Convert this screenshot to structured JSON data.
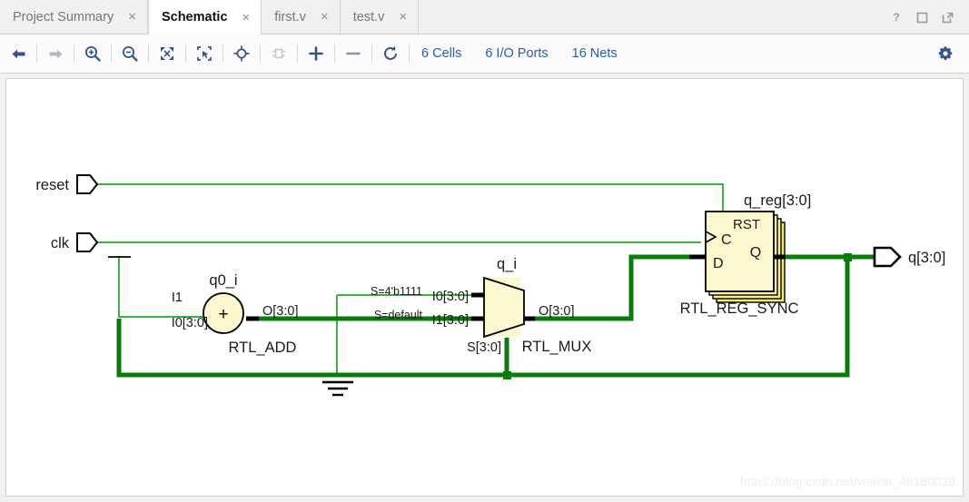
{
  "window": {
    "controls": [
      {
        "name": "help-button",
        "glyph": "?"
      },
      {
        "name": "maximize-button",
        "glyph": "□"
      },
      {
        "name": "float-button",
        "glyph": "↗"
      }
    ]
  },
  "tabs": [
    {
      "label": "Project Summary",
      "close": "×",
      "active": false
    },
    {
      "label": "Schematic",
      "close": "×",
      "active": true
    },
    {
      "label": "first.v",
      "close": "×",
      "active": false
    },
    {
      "label": "test.v",
      "close": "×",
      "active": false
    }
  ],
  "toolbar": {
    "buttons": [
      {
        "name": "back-arrow-icon",
        "title": "Back",
        "enabled": true
      },
      {
        "name": "forward-arrow-icon",
        "title": "Forward",
        "enabled": false
      },
      {
        "name": "zoom-in-icon",
        "title": "Zoom In",
        "enabled": true
      },
      {
        "name": "zoom-out-icon",
        "title": "Zoom Out",
        "enabled": true
      },
      {
        "name": "zoom-fit-icon",
        "title": "Zoom Fit",
        "enabled": true
      },
      {
        "name": "zoom-area-icon",
        "title": "Zoom Area",
        "enabled": true
      },
      {
        "name": "crosshair-icon",
        "title": "Center",
        "enabled": true
      },
      {
        "name": "cell-icon",
        "title": "Cell",
        "enabled": false
      },
      {
        "name": "expand-plus-icon",
        "title": "Expand",
        "enabled": true
      },
      {
        "name": "collapse-minus-icon",
        "title": "Collapse",
        "enabled": true
      },
      {
        "name": "reload-icon",
        "title": "Reload",
        "enabled": true
      }
    ],
    "stats": [
      {
        "name": "cells-count",
        "label": "6 Cells"
      },
      {
        "name": "io-ports-count",
        "label": "6 I/O Ports"
      },
      {
        "name": "nets-count",
        "label": "16 Nets"
      }
    ],
    "settings": {
      "name": "gear-icon",
      "label": "Settings"
    }
  },
  "colors": {
    "accent_blue": "#2a5db0",
    "toolbar_icon": "#33538f",
    "thin_wire": "#22aa22",
    "bus_wire": "#0a7c0a",
    "cell_fill": "#fbf8cf",
    "cell_stroke": "#000000",
    "tab_active_bg": "#ffffff",
    "panel_bg": "#f0f0f0"
  },
  "schematic": {
    "input_ports": [
      {
        "name": "port-reset",
        "label": "reset"
      },
      {
        "name": "port-clk",
        "label": "clk"
      }
    ],
    "output_ports": [
      {
        "name": "port-q",
        "label": "q[3:0]"
      }
    ],
    "cells": [
      {
        "name": "cell-adder",
        "instance": "q0_i",
        "type": "RTL_ADD",
        "symbol": "+",
        "shape": "circle",
        "pins": [
          {
            "name": "pin-i1",
            "label": "I1"
          },
          {
            "name": "pin-i0",
            "label": "I0[3:0]"
          },
          {
            "name": "pin-o",
            "label": "O[3:0]"
          }
        ]
      },
      {
        "name": "cell-mux",
        "instance": "q_i",
        "type": "RTL_MUX",
        "shape": "trapezoid",
        "pins": [
          {
            "name": "pin-i0",
            "label": "I0[3:0]"
          },
          {
            "name": "pin-i1",
            "label": "I1[3:0]"
          },
          {
            "name": "pin-s",
            "label": "S[3:0]"
          },
          {
            "name": "pin-o",
            "label": "O[3:0]"
          }
        ],
        "select_annotations": [
          {
            "name": "mux-sel-i0",
            "label": "S=4'b1111"
          },
          {
            "name": "mux-sel-i1",
            "label": "S=default"
          }
        ]
      },
      {
        "name": "cell-register",
        "instance": "q_reg[3:0]",
        "type": "RTL_REG_SYNC",
        "shape": "stacked-box",
        "pins": [
          {
            "name": "pin-rst",
            "label": "RST"
          },
          {
            "name": "pin-c",
            "label": "C"
          },
          {
            "name": "pin-d",
            "label": "D"
          },
          {
            "name": "pin-q",
            "label": "Q"
          }
        ]
      }
    ],
    "ground": {
      "name": "ground-symbol",
      "label": ""
    }
  },
  "watermark": {
    "text": "https://blog.csdn.net/weixin_48180029"
  }
}
